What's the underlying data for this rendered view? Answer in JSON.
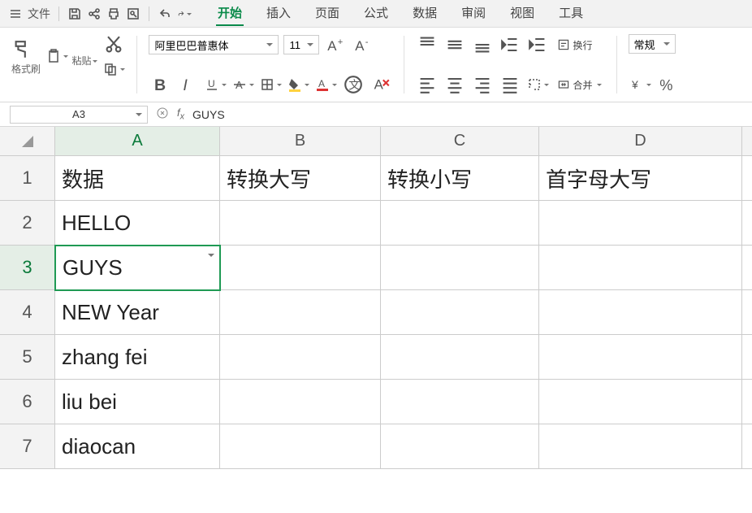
{
  "menu": {
    "file": "文件"
  },
  "tabs": [
    "开始",
    "插入",
    "页面",
    "公式",
    "数据",
    "审阅",
    "视图",
    "工具"
  ],
  "active_tab": 0,
  "ribbon": {
    "format_painter": "格式刷",
    "paste": "粘贴",
    "font_name": "阿里巴巴普惠体",
    "font_size": "11",
    "wrap": "换行",
    "merge": "合并",
    "number_format": "常规"
  },
  "namebox": "A3",
  "formula": "GUYS",
  "columns": [
    "A",
    "B",
    "C",
    "D"
  ],
  "rows": [
    "1",
    "2",
    "3",
    "4",
    "5",
    "6",
    "7"
  ],
  "selected": {
    "row": 3,
    "col": "A"
  },
  "data": {
    "A": [
      "数据",
      "HELLO",
      "GUYS",
      "NEW Year",
      "zhang fei",
      "liu bei",
      "diaocan"
    ],
    "B": [
      "转换大写",
      "",
      "",
      "",
      "",
      "",
      ""
    ],
    "C": [
      "转换小写",
      "",
      "",
      "",
      "",
      "",
      ""
    ],
    "D": [
      "首字母大写",
      "",
      "",
      "",
      "",
      "",
      ""
    ]
  },
  "chart_data": {
    "type": "table",
    "columns": [
      "数据",
      "转换大写",
      "转换小写",
      "首字母大写"
    ],
    "rows": [
      [
        "HELLO",
        "",
        "",
        ""
      ],
      [
        "GUYS",
        "",
        "",
        ""
      ],
      [
        "NEW Year",
        "",
        "",
        ""
      ],
      [
        "zhang fei",
        "",
        "",
        ""
      ],
      [
        "liu bei",
        "",
        "",
        ""
      ],
      [
        "diaocan",
        "",
        "",
        ""
      ]
    ]
  }
}
